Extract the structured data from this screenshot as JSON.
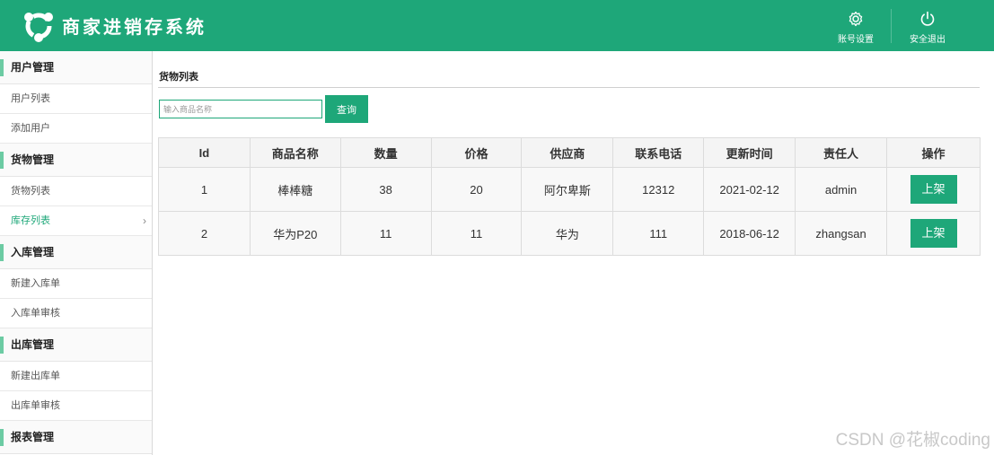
{
  "header": {
    "app_title": "商家进销存系统",
    "account_settings_label": "账号设置",
    "logout_label": "安全退出",
    "background_color": "#1ea779"
  },
  "sidebar": {
    "groups": [
      {
        "title": "用户管理",
        "items": [
          {
            "label": "用户列表"
          },
          {
            "label": "添加用户"
          }
        ]
      },
      {
        "title": "货物管理",
        "items": [
          {
            "label": "货物列表"
          },
          {
            "label": "库存列表",
            "active": true,
            "chevron": "›"
          }
        ]
      },
      {
        "title": "入库管理",
        "items": [
          {
            "label": "新建入库单"
          },
          {
            "label": "入库单审核"
          }
        ]
      },
      {
        "title": "出库管理",
        "items": [
          {
            "label": "新建出库单"
          },
          {
            "label": "出库单审核"
          }
        ]
      },
      {
        "title": "报表管理",
        "items": []
      }
    ]
  },
  "main": {
    "page_title": "货物列表",
    "search": {
      "placeholder": "输入商品名称",
      "value": "",
      "button_label": "查询"
    },
    "table": {
      "columns": [
        "Id",
        "商品名称",
        "数量",
        "价格",
        "供应商",
        "联系电话",
        "更新时间",
        "责任人",
        "操作"
      ],
      "rows": [
        {
          "id": "1",
          "name": "棒棒糖",
          "quantity": "38",
          "price": "20",
          "supplier": "阿尔卑斯",
          "phone": "12312",
          "updated": "2021-02-12",
          "owner": "admin",
          "action": "上架"
        },
        {
          "id": "2",
          "name": "华为P20",
          "quantity": "11",
          "price": "11",
          "supplier": "华为",
          "phone": "111",
          "updated": "2018-06-12",
          "owner": "zhangsan",
          "action": "上架"
        }
      ]
    }
  },
  "watermark": "CSDN @花椒coding",
  "colors": {
    "accent": "#1ea779",
    "sidebar_marker": "#6ccba3"
  }
}
